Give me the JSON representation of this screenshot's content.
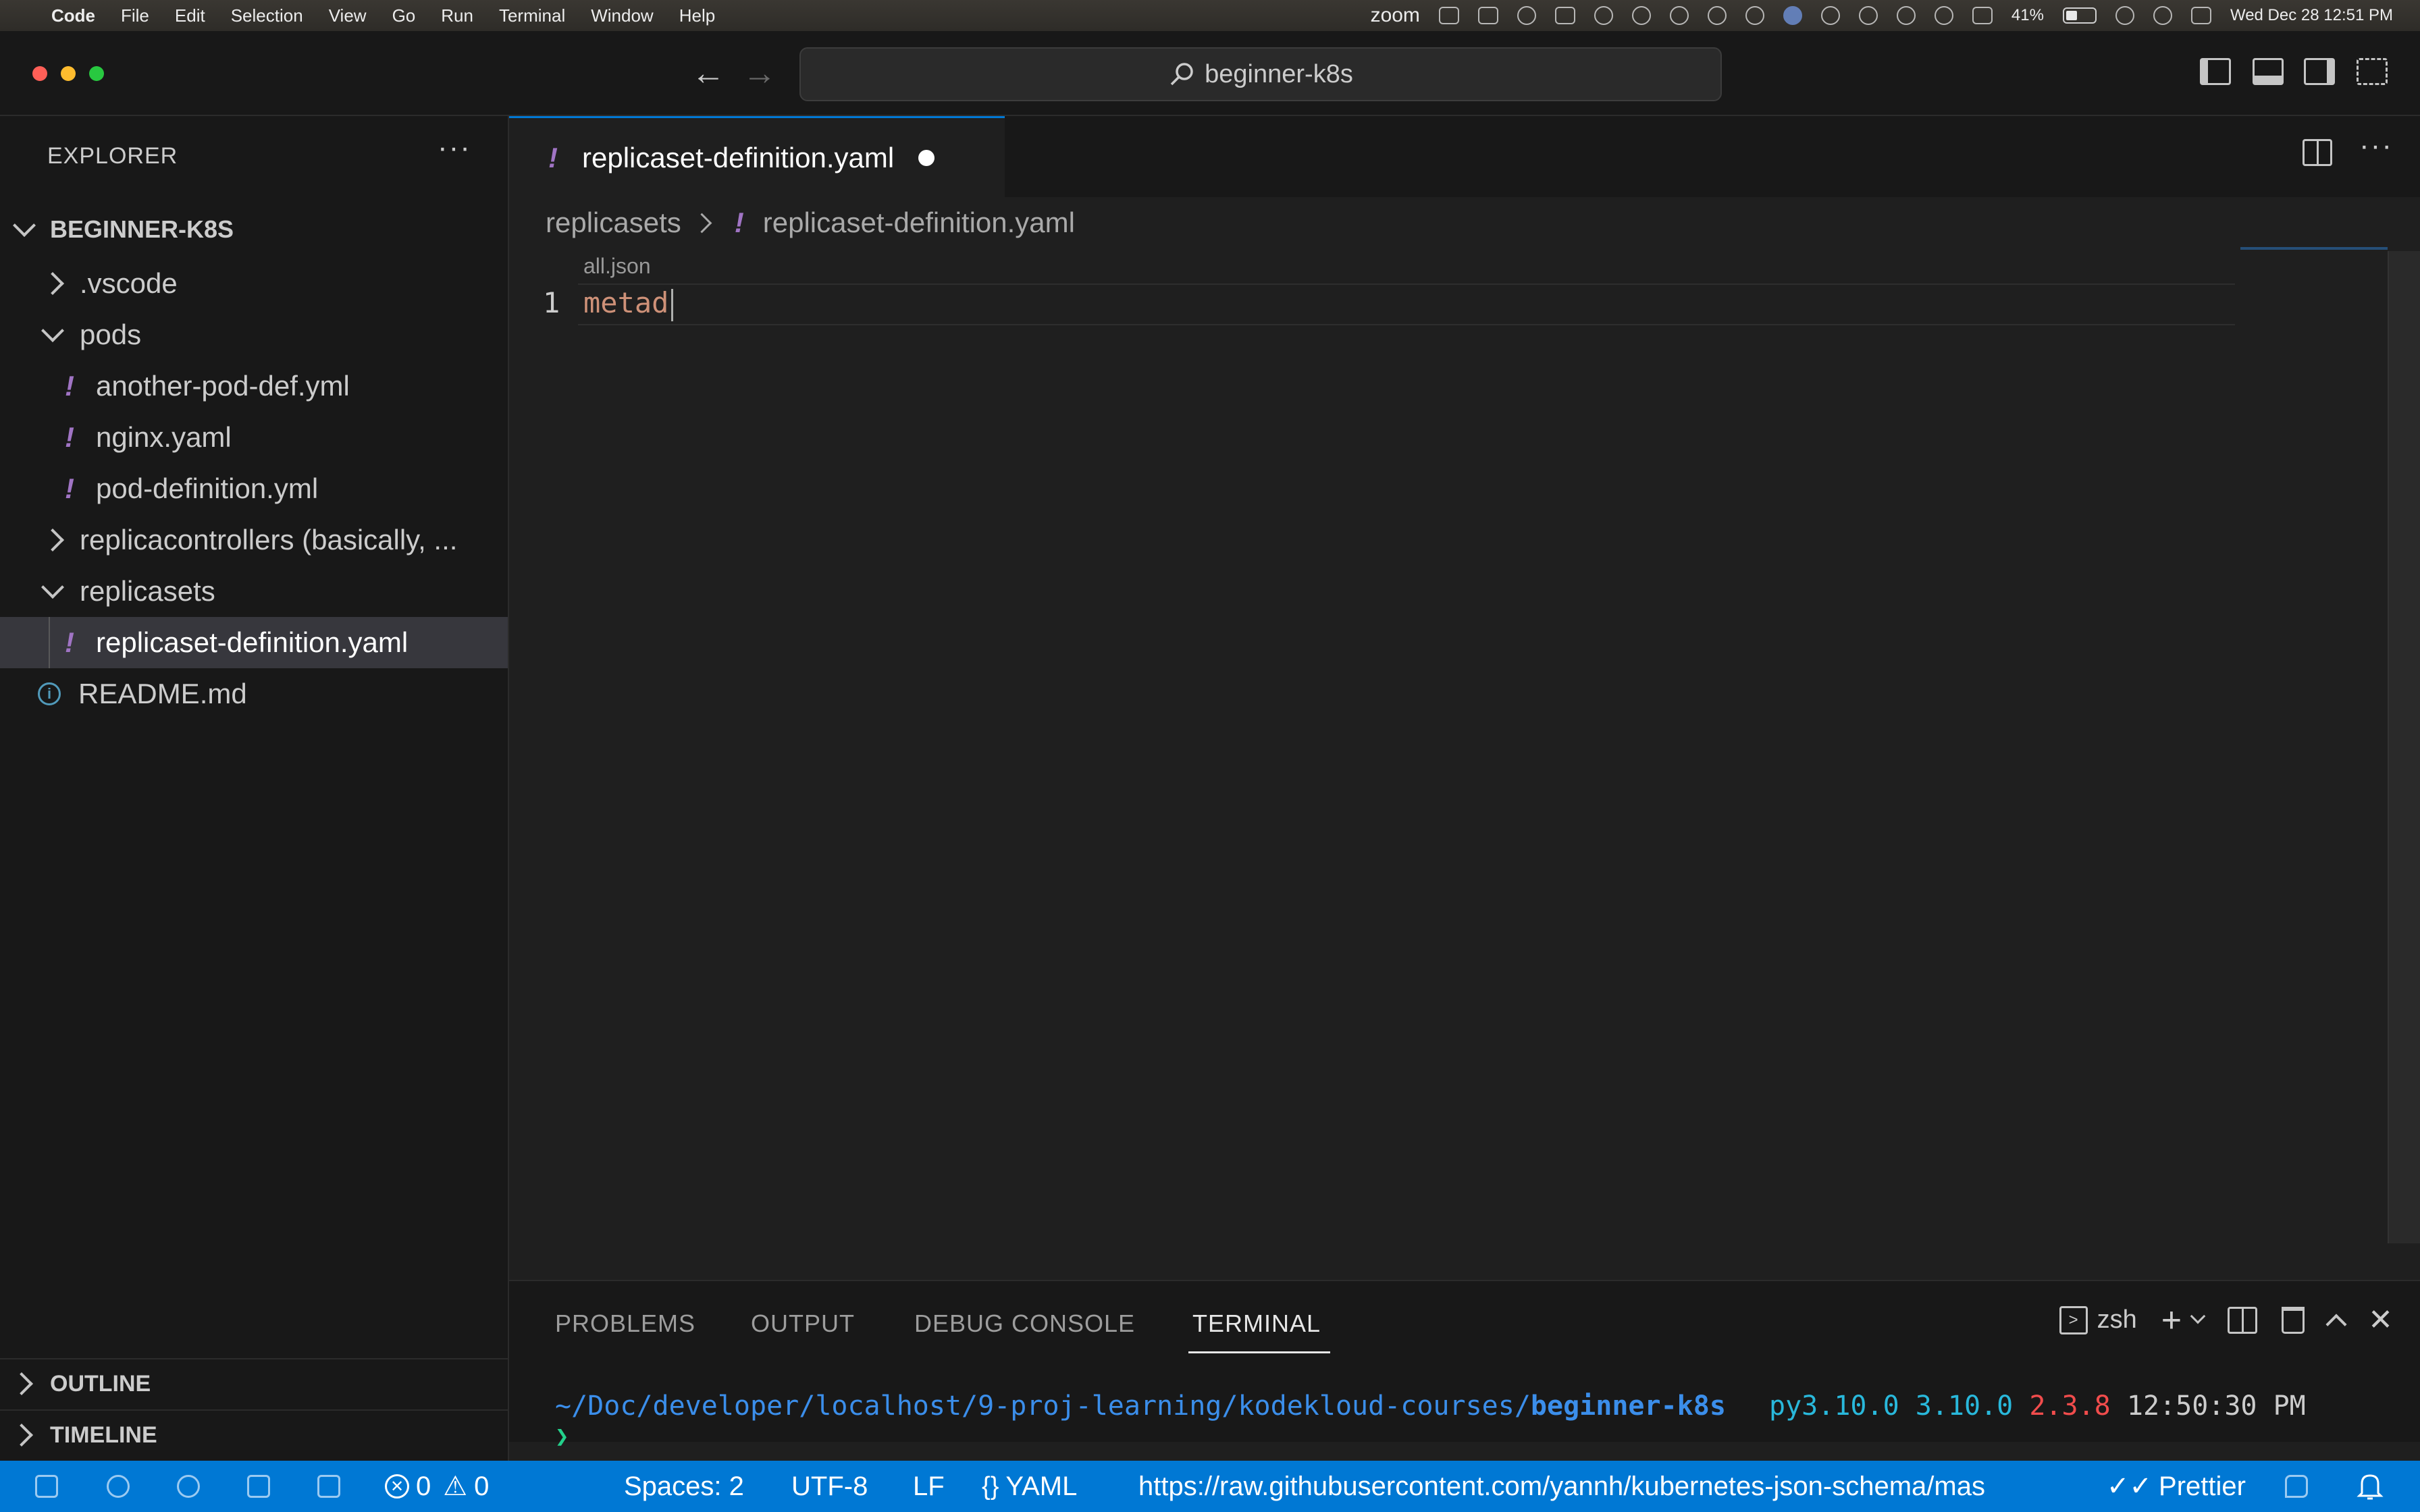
{
  "menubar": {
    "apple": "",
    "app_name": "Code",
    "menus": [
      "File",
      "Edit",
      "Selection",
      "View",
      "Go",
      "Run",
      "Terminal",
      "Window",
      "Help"
    ],
    "zoom": "zoom",
    "battery_percent": "41%",
    "datetime": "Wed Dec 28  12:51 PM"
  },
  "titlebar": {
    "search_text": "beginner-k8s"
  },
  "sidebar": {
    "title": "EXPLORER",
    "more": "···",
    "root": "BEGINNER-K8S",
    "items": [
      {
        "label": ".vscode",
        "kind": "folder",
        "expanded": false
      },
      {
        "label": "pods",
        "kind": "folder",
        "expanded": true
      },
      {
        "label": "another-pod-def.yml",
        "kind": "yaml"
      },
      {
        "label": "nginx.yaml",
        "kind": "yaml"
      },
      {
        "label": "pod-definition.yml",
        "kind": "yaml"
      },
      {
        "label": "replicacontrollers (basically, ...",
        "kind": "folder",
        "expanded": false
      },
      {
        "label": "replicasets",
        "kind": "folder",
        "expanded": true
      },
      {
        "label": "replicaset-definition.yaml",
        "kind": "yaml",
        "selected": true
      },
      {
        "label": "README.md",
        "kind": "info"
      }
    ],
    "outline": "OUTLINE",
    "timeline": "TIMELINE"
  },
  "editor": {
    "tab_label": "replicaset-definition.yaml",
    "breadcrumb": [
      "replicasets",
      "replicaset-definition.yaml"
    ],
    "codelens": "all.json",
    "line_number": "1",
    "code": "metad",
    "more": "···"
  },
  "panel": {
    "tabs": [
      "PROBLEMS",
      "OUTPUT",
      "DEBUG CONSOLE",
      "TERMINAL"
    ],
    "active_tab": "TERMINAL",
    "shell": "zsh",
    "terminal": {
      "path_prefix": "~/Doc/developer/localhost/9-proj-learning/kodekloud-courses/",
      "path_dir": "beginner-k8s",
      "python_glyph": "",
      "python_env": "py3.10.0",
      "python_version": "3.10.0",
      "ruby_glyph": "",
      "ruby_version": "2.3.8",
      "time": "12:50:30 PM",
      "prompt": "❯"
    }
  },
  "statusbar": {
    "errors": "0",
    "warnings": "0",
    "spaces": "Spaces: 2",
    "encoding": "UTF-8",
    "eol": "LF",
    "language": "YAML",
    "schema_url": "https://raw.githubusercontent.com/yannh/kubernetes-json-schema/mas",
    "prettier": "Prettier"
  },
  "colors": {
    "accent": "#0078d4",
    "yaml_icon": "#a074c4",
    "code_string": "#ce9178",
    "terminal_path": "#3b8eea",
    "terminal_teal": "#29b8db",
    "terminal_red": "#f14c4c",
    "prompt_green": "#23d18b"
  }
}
